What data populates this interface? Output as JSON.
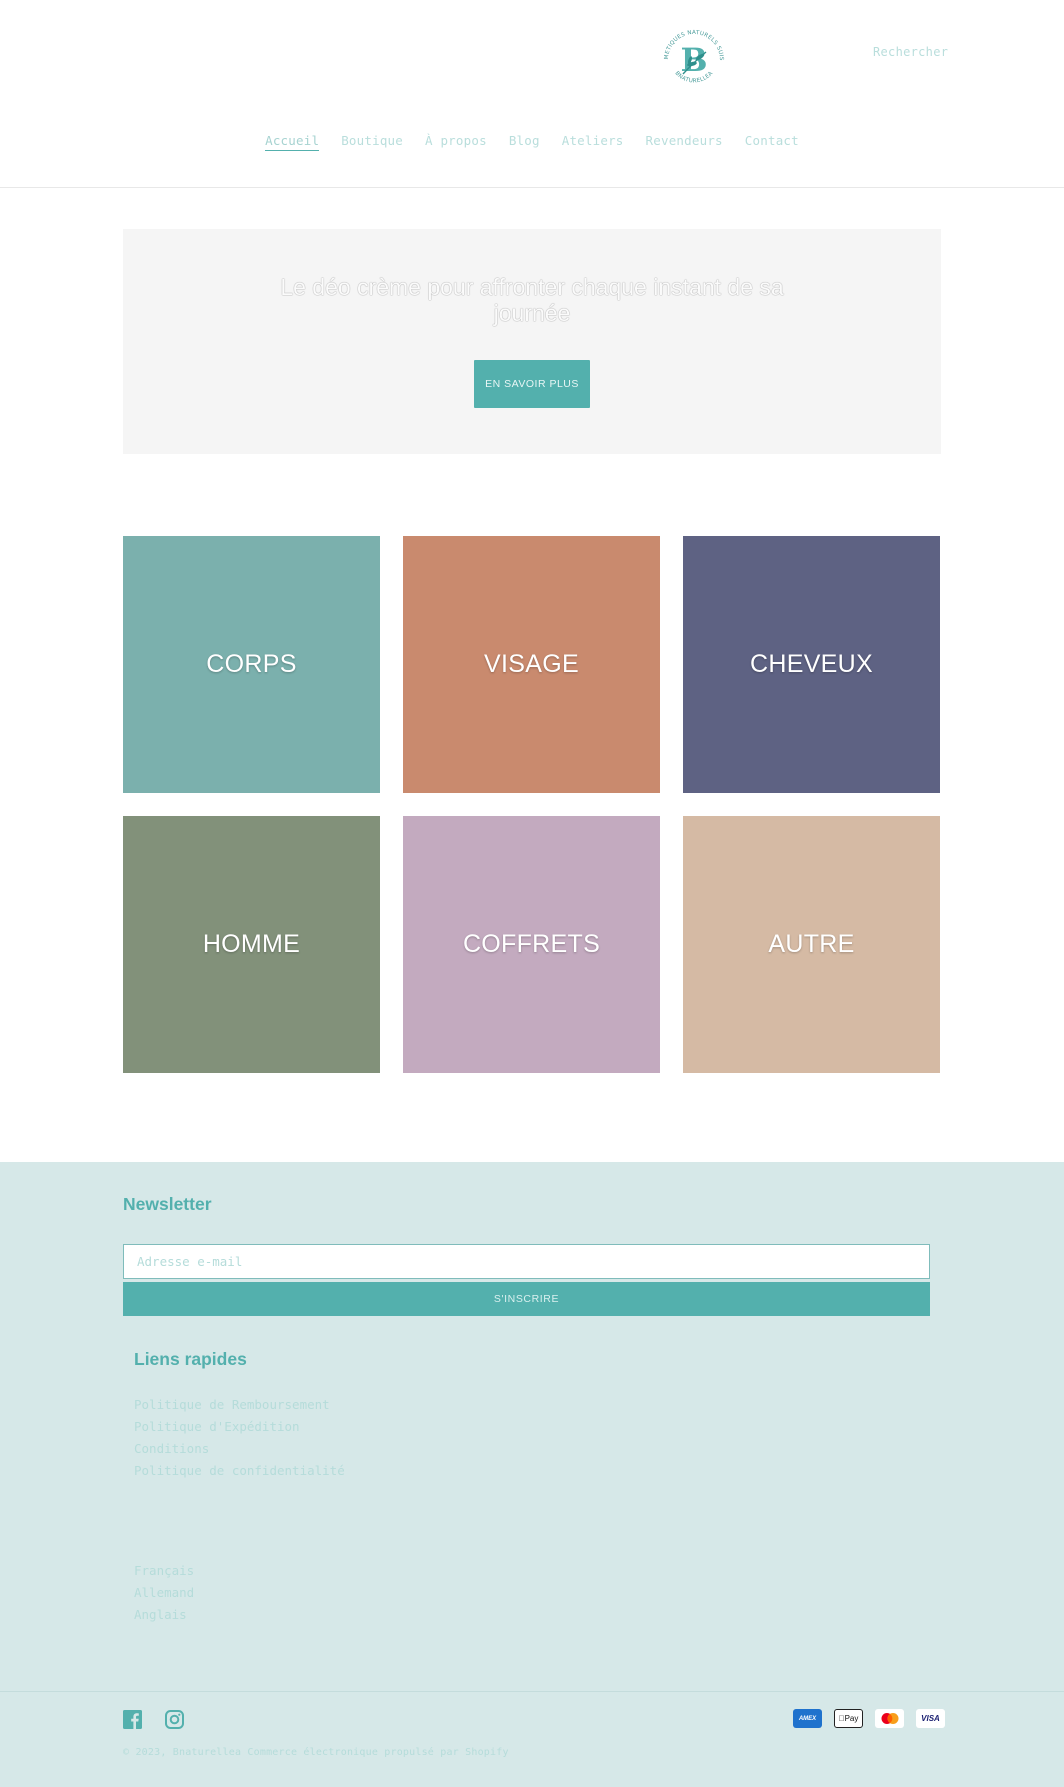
{
  "header": {
    "logo": {
      "alt": "Bnaturellea - Cosmétiques naturels suisses",
      "ring_text_top": "COSMETIQUES NATURELS SUISSES",
      "ring_text_bottom": "BNATURELLEA",
      "monogram": "B"
    },
    "search_label": "Rechercher",
    "nav": [
      {
        "label": "Accueil",
        "active": true
      },
      {
        "label": "Boutique",
        "active": false
      },
      {
        "label": "À propos",
        "active": false
      },
      {
        "label": "Blog",
        "active": false
      },
      {
        "label": "Ateliers",
        "active": false
      },
      {
        "label": "Revendeurs",
        "active": false
      },
      {
        "label": "Contact",
        "active": false
      }
    ]
  },
  "hero": {
    "title": "Le déo crème pour affronter chaque instant de sa journée",
    "button_label": "EN SAVOIR PLUS"
  },
  "categories": [
    {
      "label": "CORPS",
      "color": "#7bb0ad"
    },
    {
      "label": "VISAGE",
      "color": "#c98a6e"
    },
    {
      "label": "CHEVEUX",
      "color": "#5e6283"
    },
    {
      "label": "HOMME",
      "color": "#82917a"
    },
    {
      "label": "COFFRETS",
      "color": "#c3aabf"
    },
    {
      "label": "AUTRE",
      "color": "#d5baa4"
    }
  ],
  "footer": {
    "newsletter": {
      "title": "Newsletter",
      "email_placeholder": "Adresse e-mail",
      "email_value": "",
      "subscribe_label": "S'INSCRIRE"
    },
    "quick_links": {
      "title": "Liens rapides",
      "items": [
        "Politique de Remboursement",
        "Politique d'Expédition",
        "Conditions",
        "Politique de confidentialité"
      ]
    },
    "languages": [
      "Français",
      "Allemand",
      "Anglais"
    ],
    "social": [
      {
        "name": "Facebook",
        "icon": "facebook-icon"
      },
      {
        "name": "Instagram",
        "icon": "instagram-icon"
      }
    ],
    "payments": [
      {
        "name": "American Express",
        "label": "AMEX"
      },
      {
        "name": "Apple Pay",
        "label": "Pay"
      },
      {
        "name": "Mastercard",
        "label": ""
      },
      {
        "name": "Visa",
        "label": "VISA"
      }
    ],
    "copyright": "© 2023, Bnaturellea Commerce électronique propulsé par Shopify"
  },
  "colors": {
    "accent": "#53b0ad",
    "footer_bg": "#d6e8e8",
    "hero_bg": "#f5f5f5",
    "link_light": "#b5dcda"
  }
}
